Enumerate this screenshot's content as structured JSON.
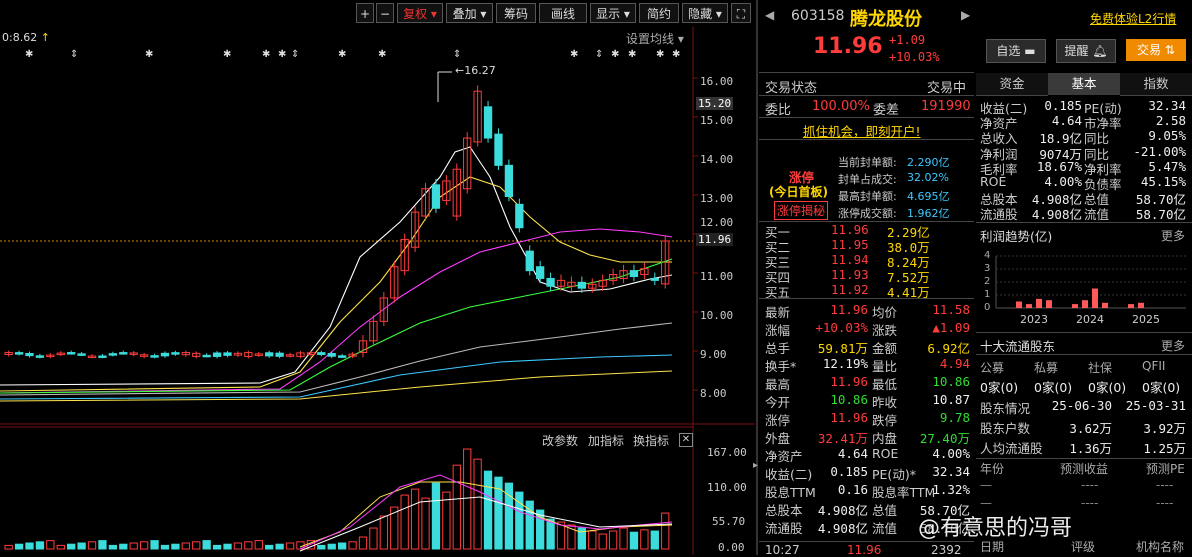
{
  "toolbar": {
    "buttons": [
      "+",
      "−",
      "复权",
      "叠加",
      "筹码",
      "画线",
      "显示",
      "简约",
      "隐藏"
    ],
    "fullscreen_icon": "expand-icon"
  },
  "chart": {
    "top_left_label": "0:8.62",
    "up_arrow": "↑",
    "settings_label": "设置均线",
    "peak_label": "16.27",
    "price_ticks": [
      "16.00",
      "15.20",
      "15.00",
      "14.00",
      "13.00",
      "12.00",
      "11.96",
      "11.00",
      "10.00",
      "9.00",
      "8.00"
    ],
    "star_markers": "✱",
    "current_price_label": "11.96",
    "indicator_links": [
      "改参数",
      "加指标",
      "换指标"
    ],
    "close_icon": "close-icon",
    "vol_ticks": [
      "167.00",
      "110.00",
      "55.70",
      "0.00"
    ]
  },
  "stock": {
    "code": "603158",
    "name": "腾龙股份",
    "price": "11.96",
    "change": "+1.09",
    "change_pct": "+10.03%",
    "l2_link": "免费体验L2行情",
    "btn_watch": "自选",
    "btn_alert": "提醒",
    "btn_trade": "交易"
  },
  "status": {
    "label": "交易状态",
    "value": "交易中",
    "weibi_label": "委比",
    "weibi_value": "100.00%",
    "weicha_label": "委差",
    "weicha_value": "191990",
    "promo": "抓住机会，即刻开户!"
  },
  "limit_up": {
    "title": "涨停",
    "subtitle": "(今日首板)",
    "button": "涨停揭秘",
    "rows": [
      {
        "label": "当前封单额:",
        "value": "2.290亿"
      },
      {
        "label": "封单占成交:",
        "value": "32.02%"
      },
      {
        "label": "最高封单额:",
        "value": "4.695亿"
      },
      {
        "label": "涨停成交额:",
        "value": "1.962亿"
      }
    ]
  },
  "bids": [
    {
      "label": "买一",
      "price": "11.96",
      "vol": "2.29亿"
    },
    {
      "label": "买二",
      "price": "11.95",
      "vol": "38.0万"
    },
    {
      "label": "买三",
      "price": "11.94",
      "vol": "8.24万"
    },
    {
      "label": "买四",
      "price": "11.93",
      "vol": "7.52万"
    },
    {
      "label": "买五",
      "price": "11.92",
      "vol": "4.41万"
    }
  ],
  "quote": [
    {
      "l1": "最新",
      "v1": "11.96",
      "c1": "red",
      "l2": "均价",
      "v2": "11.58",
      "c2": "red"
    },
    {
      "l1": "涨幅",
      "v1": "+10.03%",
      "c1": "red",
      "l2": "涨跌",
      "v2": "▲1.09",
      "c2": "red"
    },
    {
      "l1": "总手",
      "v1": "59.81万",
      "c1": "yellow",
      "l2": "金额",
      "v2": "6.92亿",
      "c2": "yellow"
    },
    {
      "l1": "换手*",
      "v1": "12.19%",
      "c1": "white",
      "l2": "量比",
      "v2": "4.94",
      "c2": "red"
    },
    {
      "l1": "最高",
      "v1": "11.96",
      "c1": "red",
      "l2": "最低",
      "v2": "10.86",
      "c2": "green"
    },
    {
      "l1": "今开",
      "v1": "10.86",
      "c1": "green",
      "l2": "昨收",
      "v2": "10.87",
      "c2": "white"
    },
    {
      "l1": "涨停",
      "v1": "11.96",
      "c1": "red",
      "l2": "跌停",
      "v2": "9.78",
      "c2": "green"
    },
    {
      "l1": "外盘",
      "v1": "32.41万",
      "c1": "red",
      "l2": "内盘",
      "v2": "27.40万",
      "c2": "green"
    },
    {
      "l1": "净资产",
      "v1": "4.64",
      "c1": "white",
      "l2": "ROE",
      "v2": "4.00%",
      "c2": "white"
    },
    {
      "l1": "收益(二)",
      "v1": "0.185",
      "c1": "white",
      "l2": "PE(动)*",
      "v2": "32.34",
      "c2": "white"
    },
    {
      "l1": "股息TTM",
      "v1": "0.16",
      "c1": "white",
      "l2": "股息率TTM",
      "v2": "1.32%",
      "c2": "white"
    },
    {
      "l1": "总股本",
      "v1": "4.908亿",
      "c1": "white",
      "l2": "总值",
      "v2": "58.70亿",
      "c2": "white"
    },
    {
      "l1": "流通股",
      "v1": "4.908亿",
      "c1": "white",
      "l2": "流值",
      "v2": "58.70亿",
      "c2": "white"
    }
  ],
  "tick": {
    "time": "10:27",
    "price": "11.96",
    "vol": "2392"
  },
  "tabs": [
    "资金",
    "基本",
    "指数"
  ],
  "fundamentals": [
    {
      "l1": "收益(二)",
      "v1": "0.185",
      "l2": "PE(动)",
      "v2": "32.34"
    },
    {
      "l1": "净资产",
      "v1": "4.64",
      "l2": "市净率",
      "v2": "2.58"
    },
    {
      "l1": "总收入",
      "v1": "18.9亿",
      "l2": "同比",
      "v2": "9.05%"
    },
    {
      "l1": "净利润",
      "v1": "9074万",
      "l2": "同比",
      "v2": "-21.00%"
    },
    {
      "l1": "毛利率",
      "v1": "18.67%",
      "l2": "净利率",
      "v2": "5.47%"
    },
    {
      "l1": "ROE",
      "v1": "4.00%",
      "l2": "负债率",
      "v2": "45.15%"
    },
    {
      "l1": "总股本",
      "v1": "4.908亿",
      "l2": "总值",
      "v2": "58.70亿"
    },
    {
      "l1": "流通股",
      "v1": "4.908亿",
      "l2": "流值",
      "v2": "58.70亿"
    }
  ],
  "profit_trend": {
    "title": "利润趋势(亿)",
    "more": "更多",
    "y_ticks": [
      "4",
      "3",
      "2",
      "1",
      "0"
    ],
    "years": [
      "2023",
      "2024",
      "2025"
    ]
  },
  "chart_data": {
    "type": "bar",
    "title": "利润趋势(亿)",
    "categories": [
      "2023",
      "",
      "",
      "",
      "2024",
      "",
      "",
      "",
      "2025",
      ""
    ],
    "values": [
      0.5,
      0.3,
      0.7,
      0.6,
      0.3,
      0.6,
      1.5,
      0.4,
      0.3,
      0.4
    ],
    "ylim": [
      0,
      4
    ]
  },
  "holders": {
    "title": "十大流通股东",
    "more": "更多",
    "headers": [
      "公募",
      "私募",
      "社保",
      "QFII"
    ],
    "counts": [
      "0家(0)",
      "0家(0)",
      "0家(0)",
      "0家(0)"
    ],
    "rows": [
      {
        "label": "股东情况",
        "a": "25-06-30",
        "b": "25-03-31"
      },
      {
        "label": "股东户数",
        "a": "3.62万",
        "b": "3.92万"
      },
      {
        "label": "人均流通股",
        "a": "1.36万",
        "b": "1.25万"
      }
    ]
  },
  "forecast": {
    "headers": [
      "年份",
      "预测收益",
      "预测PE"
    ],
    "placeholder": "----",
    "footer": [
      "日期",
      "评级",
      "机构名称"
    ]
  },
  "watermark": "@有意思的冯哥",
  "colors": {
    "up": "#ff3c3c",
    "down": "#2fdc2f",
    "bg": "#000000",
    "accent": "#ffd700"
  }
}
